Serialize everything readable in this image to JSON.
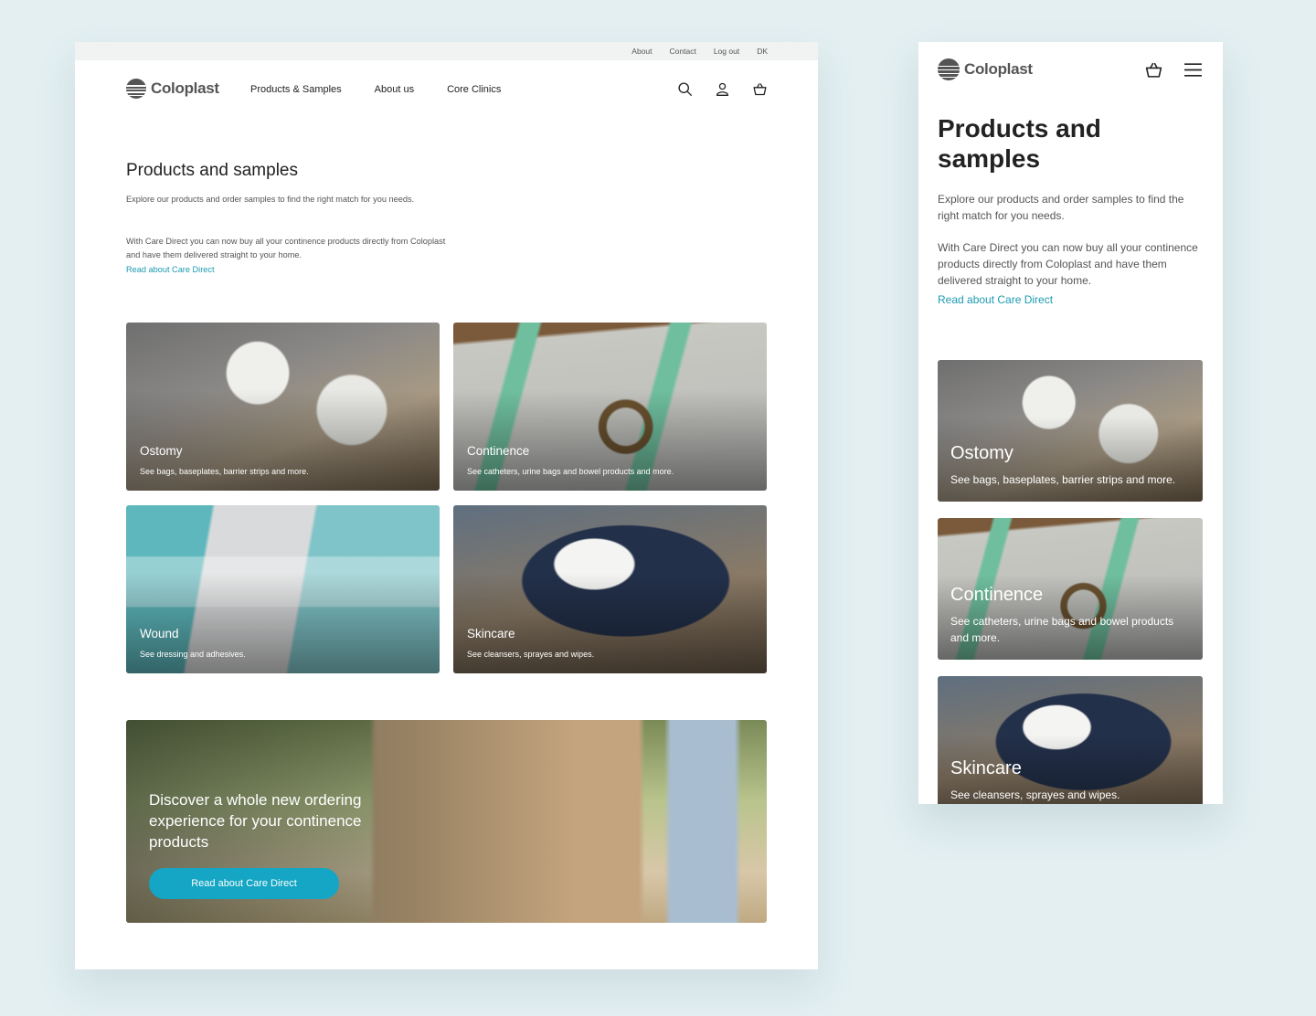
{
  "desktop": {
    "utility": [
      "About",
      "Contact",
      "Log out",
      "DK"
    ],
    "brand": "Coloplast",
    "nav": [
      "Products & Samples",
      "About us",
      "Core Clinics"
    ],
    "title": "Products and samples",
    "intro": "Explore our products and order samples to find the right match for you needs.",
    "care": "With Care Direct you can now buy all your continence products directly from Coloplast and have them delivered straight to your home.",
    "link": "Read about Care Direct",
    "cards": [
      {
        "title": "Ostomy",
        "sub": "See bags, baseplates, barrier strips and more."
      },
      {
        "title": "Continence",
        "sub": "See catheters, urine bags and bowel products and more."
      },
      {
        "title": "Wound",
        "sub": "See dressing and adhesives."
      },
      {
        "title": "Skincare",
        "sub": "See cleansers, sprayes and wipes."
      }
    ],
    "banner": {
      "title": "Discover a whole new ordering experience for your continence products",
      "button": "Read about Care Direct"
    }
  },
  "mobile": {
    "brand": "Coloplast",
    "title": "Products and samples",
    "intro": "Explore our products and order samples to find the right match for you needs.",
    "care": "With Care Direct you can now buy all your continence products directly from Coloplast and have them delivered straight to your home.",
    "link": "Read about Care Direct",
    "cards": [
      {
        "title": "Ostomy",
        "sub": "See bags, baseplates, barrier strips and more."
      },
      {
        "title": "Continence",
        "sub": "See catheters, urine bags and bowel products and more."
      },
      {
        "title": "Skincare",
        "sub": "See cleansers, sprayes and wipes."
      }
    ]
  },
  "icons": {
    "search": "search-icon",
    "account": "user-icon",
    "basket": "basket-icon",
    "menu": "menu-icon"
  },
  "colors": {
    "accent": "#14a6c4",
    "link": "#1b9ab0",
    "logo": "#555555",
    "background": "#e3eff1"
  }
}
